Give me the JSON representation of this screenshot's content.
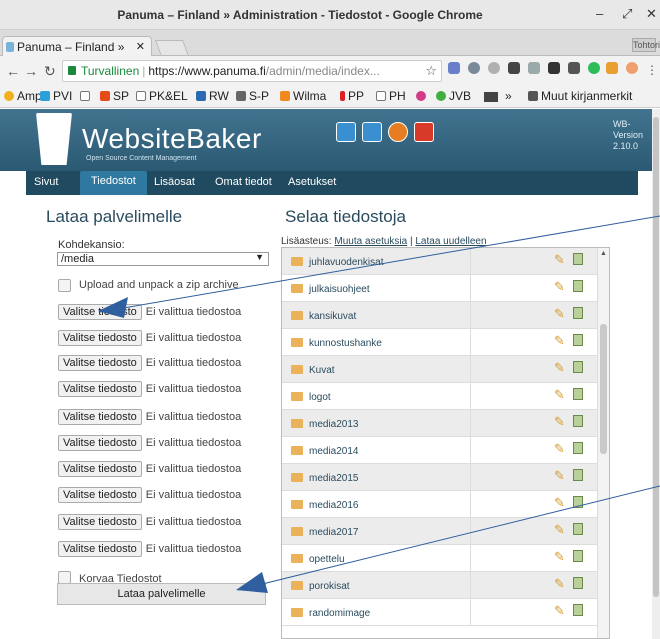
{
  "window": {
    "title": "Panuma – Finland » Administration - Tiedostot - Google Chrome"
  },
  "tab": {
    "label": "Panuma – Finland »"
  },
  "profile": {
    "label": "Tohtori"
  },
  "addressbar": {
    "secure_label": "Turvallinen",
    "url_host": "https://www.panuma.fi",
    "url_path": "/admin/media/index..."
  },
  "bookmarks": {
    "items": [
      "Amp",
      "PVI",
      "",
      "SP",
      "PK&EL",
      "RW",
      "S-P",
      "Wilma",
      "PP",
      "PH",
      "",
      "JVB"
    ],
    "overflow": "»",
    "other": "Muut kirjanmerkit"
  },
  "site": {
    "logo": "WebsiteBaker",
    "tagline": "Open Source Content Management",
    "version_label": "WB-",
    "version_label2": "Version",
    "version": "2.10.0"
  },
  "menu": {
    "items": [
      "Sivut",
      "Tiedostot",
      "Lisäosat",
      "Omat tiedot",
      "Asetukset"
    ],
    "active": "Tiedostot"
  },
  "upload": {
    "heading": "Lataa palvelimelle",
    "target_label": "Kohdekansio:",
    "target_value": "/media",
    "unzip_label": "Upload and unpack a zip archive",
    "choose_label": "Valitse tiedosto",
    "no_file": "Ei valittua tiedostoa",
    "overwrite_label": "Korvaa Tiedostot",
    "submit_label": "Lataa palvelimelle"
  },
  "browser": {
    "heading": "Selaa tiedostoja",
    "options_prefix": "Lisäasteus:",
    "change_settings": "Muuta asetuksia",
    "separator": "|",
    "reload": "Lataa uudelleen",
    "folders": [
      "juhlavuodenkisat",
      "julkaisuohjeet",
      "kansikuvat",
      "kunnostushanke",
      "Kuvat",
      "logot",
      "media2013",
      "media2014",
      "media2015",
      "media2016",
      "media2017",
      "opettelu",
      "porokisat",
      "randomimage"
    ]
  },
  "colors": {
    "header": "#2b5973",
    "menu": "#1f4a5f",
    "active_tab": "#2f78a0",
    "arrow": "#2f5f9e"
  }
}
